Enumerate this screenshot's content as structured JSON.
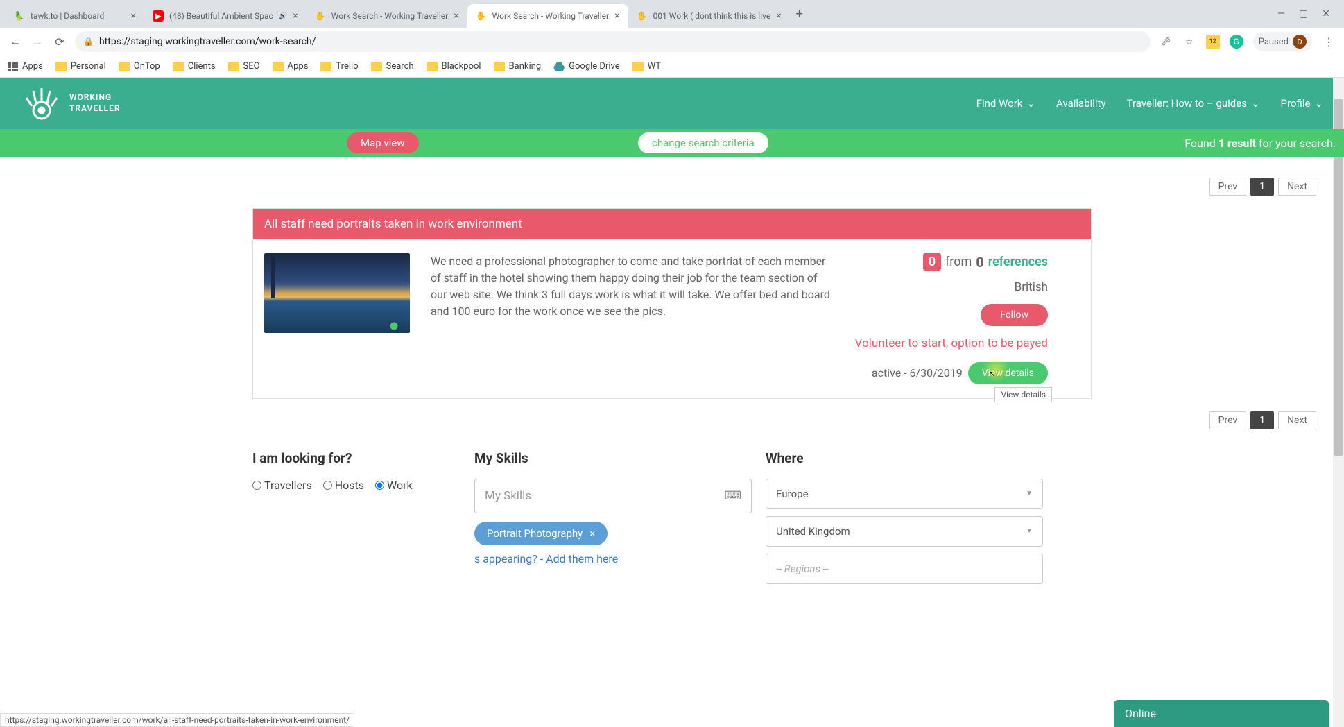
{
  "browser": {
    "tabs": [
      {
        "title": "tawk.to | Dashboard",
        "favicon": "🦜"
      },
      {
        "title": "(48) Beautiful Ambient Spac",
        "favicon": "▶",
        "audio": true
      },
      {
        "title": "Work Search - Working Traveller",
        "favicon": "✋"
      },
      {
        "title": "Work Search - Working Traveller",
        "favicon": "✋",
        "active": true
      },
      {
        "title": "001 Work ( dont think this is live",
        "favicon": "✋"
      }
    ],
    "url": "https://staging.workingtraveller.com/work-search/",
    "paused": "Paused",
    "avatar": "D",
    "bookmarks": [
      "Apps",
      "Personal",
      "OnTop",
      "Clients",
      "SEO",
      "Apps",
      "Trello",
      "Search",
      "Blackpool",
      "Banking",
      "Google Drive",
      "WT"
    ],
    "status_url": "https://staging.workingtraveller.com/work/all-staff-need-portraits-taken-in-work-environment/"
  },
  "nav": {
    "brand_line1": "WORKING",
    "brand_line2": "TRAVELLER",
    "items": [
      "Find Work",
      "Availability",
      "Traveller: How to – guides",
      "Profile"
    ]
  },
  "action_bar": {
    "map_view": "Map view",
    "change_criteria": "change search criteria",
    "found_prefix": "Found ",
    "found_count": "1 result",
    "found_suffix": " for your search."
  },
  "pagination": {
    "prev": "Prev",
    "page": "1",
    "next": "Next"
  },
  "job": {
    "title": "All staff need portraits taken in work environment",
    "description": "We need a professional photographer to come and take portriat of each member of staff in the hotel showing them happy doing their job for the team section of our web site. We think 3 full days work is what it will take. We offer bed and board and 100 euro for the work once we see the pics.",
    "ref_badge": "0",
    "ref_from": "from",
    "ref_count": "0",
    "ref_label": "references",
    "nationality": "British",
    "follow": "Follow",
    "volunteer": "Volunteer to start, option to be payed",
    "active": "active - 6/30/2019",
    "view_details": "View details",
    "tooltip": "View details"
  },
  "form": {
    "looking_heading": "I am looking for?",
    "radios": {
      "travellers": "Travellers",
      "hosts": "Hosts",
      "work": "Work"
    },
    "skills_heading": "My Skills",
    "skills_placeholder": "My Skills",
    "skill_chip": "Portrait Photography",
    "add_skills_text": "s appearing? - Add them here",
    "where_heading": "Where",
    "continent": "Europe",
    "country": "United Kingdom",
    "regions": "-- Regions --"
  },
  "chat": {
    "status": "Online"
  }
}
